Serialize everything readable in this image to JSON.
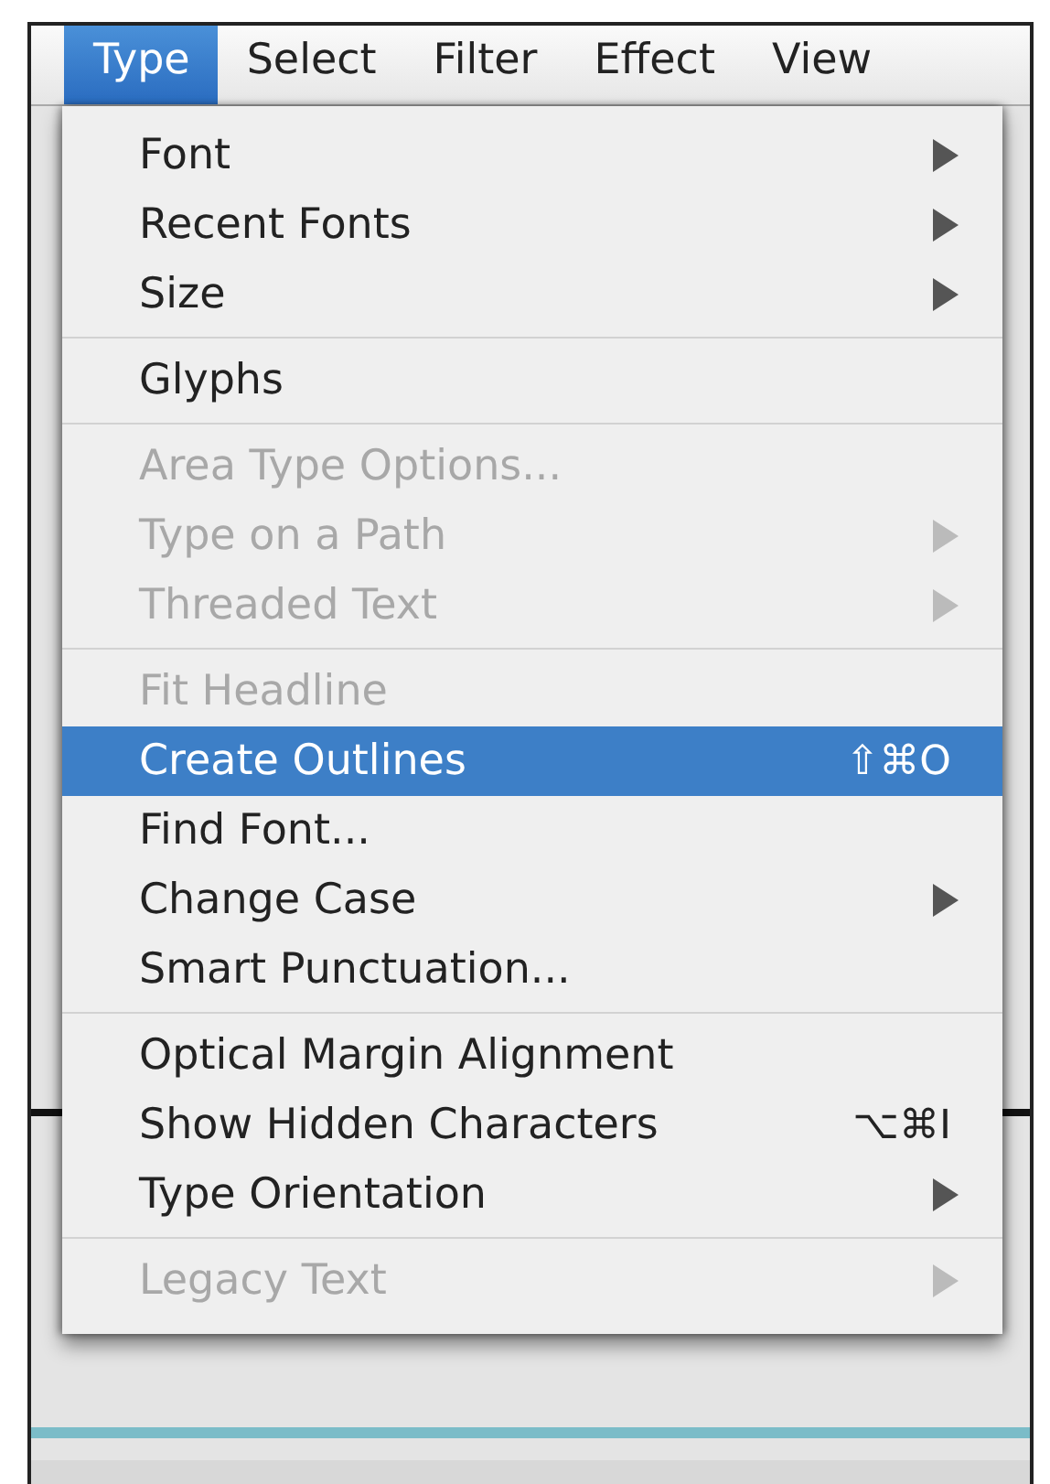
{
  "menu_bar": [
    {
      "label": "Type",
      "selected": true
    },
    {
      "label": "Select",
      "selected": false
    },
    {
      "label": "Filter",
      "selected": false
    },
    {
      "label": "Effect",
      "selected": false
    },
    {
      "label": "View",
      "selected": false
    }
  ],
  "menu": {
    "groups": [
      {
        "items": [
          {
            "label": "Font",
            "disabled": false,
            "selected": false,
            "submenu": true
          },
          {
            "label": "Recent Fonts",
            "disabled": false,
            "selected": false,
            "submenu": true
          },
          {
            "label": "Size",
            "disabled": false,
            "selected": false,
            "submenu": true
          }
        ]
      },
      {
        "items": [
          {
            "label": "Glyphs",
            "disabled": false,
            "selected": false,
            "submenu": false
          }
        ]
      },
      {
        "items": [
          {
            "label": "Area Type Options...",
            "disabled": true,
            "selected": false,
            "submenu": false
          },
          {
            "label": "Type on a Path",
            "disabled": true,
            "selected": false,
            "submenu": true
          },
          {
            "label": "Threaded Text",
            "disabled": true,
            "selected": false,
            "submenu": true
          }
        ]
      },
      {
        "items": [
          {
            "label": "Fit Headline",
            "disabled": true,
            "selected": false,
            "submenu": false
          },
          {
            "label": "Create Outlines",
            "disabled": false,
            "selected": true,
            "submenu": false,
            "shortcut": "⇧⌘O"
          },
          {
            "label": "Find Font...",
            "disabled": false,
            "selected": false,
            "submenu": false
          },
          {
            "label": "Change Case",
            "disabled": false,
            "selected": false,
            "submenu": true
          },
          {
            "label": "Smart Punctuation...",
            "disabled": false,
            "selected": false,
            "submenu": false
          }
        ]
      },
      {
        "items": [
          {
            "label": "Optical Margin Alignment",
            "disabled": false,
            "selected": false,
            "submenu": false
          },
          {
            "label": "Show Hidden Characters",
            "disabled": false,
            "selected": false,
            "submenu": false,
            "shortcut": "⌥⌘I"
          },
          {
            "label": "Type Orientation",
            "disabled": false,
            "selected": false,
            "submenu": true
          }
        ]
      },
      {
        "items": [
          {
            "label": "Legacy Text",
            "disabled": true,
            "selected": false,
            "submenu": true
          }
        ]
      }
    ]
  }
}
